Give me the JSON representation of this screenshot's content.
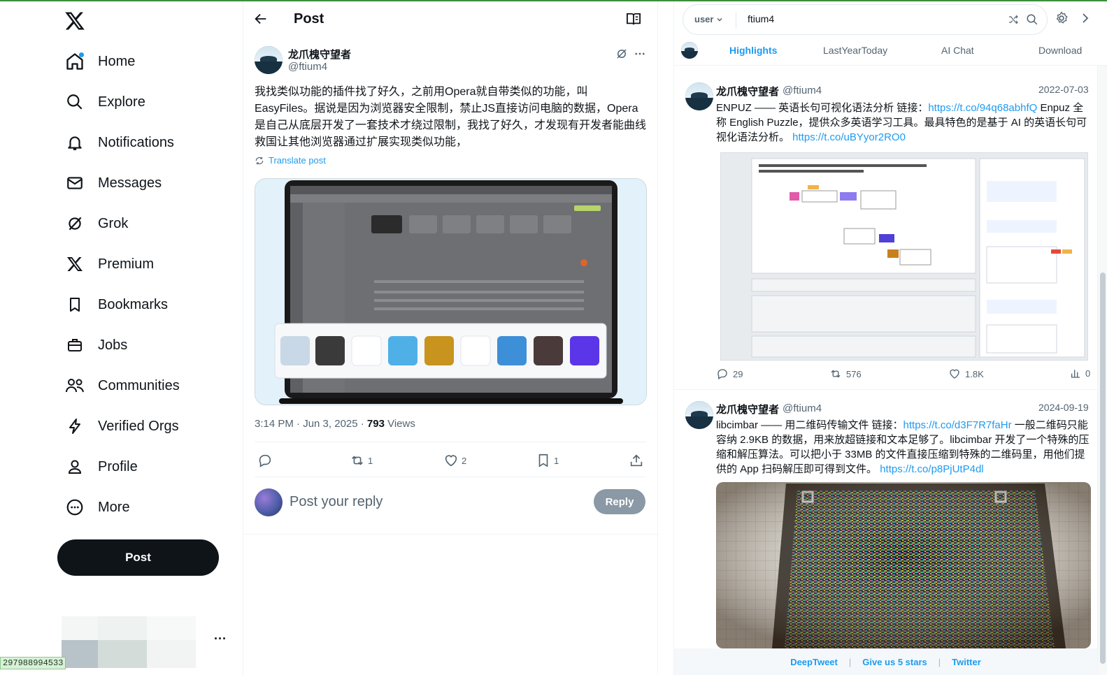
{
  "colors": {
    "accent": "#1d9bf0",
    "text": "#0f1419",
    "muted": "#536471",
    "post_button_bg": "#0f1419"
  },
  "left_nav": {
    "items": [
      {
        "label": "Home",
        "icon": "home-icon",
        "badge": true
      },
      {
        "label": "Explore",
        "icon": "search-icon"
      },
      {
        "label": "Notifications",
        "icon": "bell-icon"
      },
      {
        "label": "Messages",
        "icon": "envelope-icon"
      },
      {
        "label": "Grok",
        "icon": "grok-icon"
      },
      {
        "label": "Premium",
        "icon": "x-premium-icon"
      },
      {
        "label": "Bookmarks",
        "icon": "bookmark-icon"
      },
      {
        "label": "Jobs",
        "icon": "briefcase-icon"
      },
      {
        "label": "Communities",
        "icon": "people-icon"
      },
      {
        "label": "Verified Orgs",
        "icon": "lightning-icon"
      },
      {
        "label": "Profile",
        "icon": "person-icon"
      },
      {
        "label": "More",
        "icon": "more-circle-icon"
      }
    ],
    "post_label": "Post",
    "more_dots": "···",
    "status_url": "297988994533"
  },
  "main": {
    "title": "Post",
    "author": {
      "name": "龙爪槐守望者",
      "handle": "@ftium4"
    },
    "text": "我找类似功能的插件找了好久，之前用Opera就自带类似的功能，叫EasyFiles。据说是因为浏览器安全限制，禁止JS直接访问电脑的数据，Opera是自己从底层开发了一套技术才绕过限制，我找了好久，才发现有开发者能曲线救国让其他浏览器通过扩展实现类似功能，",
    "translate_label": "Translate post",
    "meta": {
      "time": "3:14 PM · Jun 3, 2025 · ",
      "views_count": "793",
      "views_label": " Views"
    },
    "actions": {
      "retweets": "1",
      "likes": "2",
      "bookmarks": "1"
    },
    "reply_placeholder": "Post your reply",
    "reply_label": "Reply"
  },
  "right": {
    "search": {
      "scope": "user",
      "value": "ftium4"
    },
    "tabs": [
      "Highlights",
      "LastYearToday",
      "AI Chat",
      "Download"
    ],
    "tweets": [
      {
        "name": "龙爪槐守望者",
        "handle": "@ftium4",
        "date": "2022-07-03",
        "text_1": "ENPUZ —— 英语长句可视化语法分析 链接：",
        "link_1": "https://t.co/94q68abhfQ",
        "text_2": " Enpuz 全称 English Puzzle，提供众多英语学习工具。最具特色的是基于 AI 的英语长句可视化语法分析。 ",
        "link_2": "https://t.co/uBYyor2RO0",
        "replies": "29",
        "retweets": "576",
        "likes": "1.8K",
        "views": "0"
      },
      {
        "name": "龙爪槐守望者",
        "handle": "@ftium4",
        "date": "2024-09-19",
        "text_1": "libcimbar —— 用二维码传输文件 链接：",
        "link_1": "https://t.co/d3F7R7faHr",
        "text_2": " 一般二维码只能容纳 2.9KB 的数据，用来放超链接和文本足够了。libcimbar 开发了一个特殊的压缩和解压算法。可以把小于 33MB 的文件直接压缩到特殊的二维码里，用他们提供的 App 扫码解压即可得到文件。 ",
        "link_2": "https://t.co/p8PjUtP4dl"
      }
    ],
    "footer": [
      "DeepTweet",
      "Give us 5 stars",
      "Twitter"
    ]
  }
}
